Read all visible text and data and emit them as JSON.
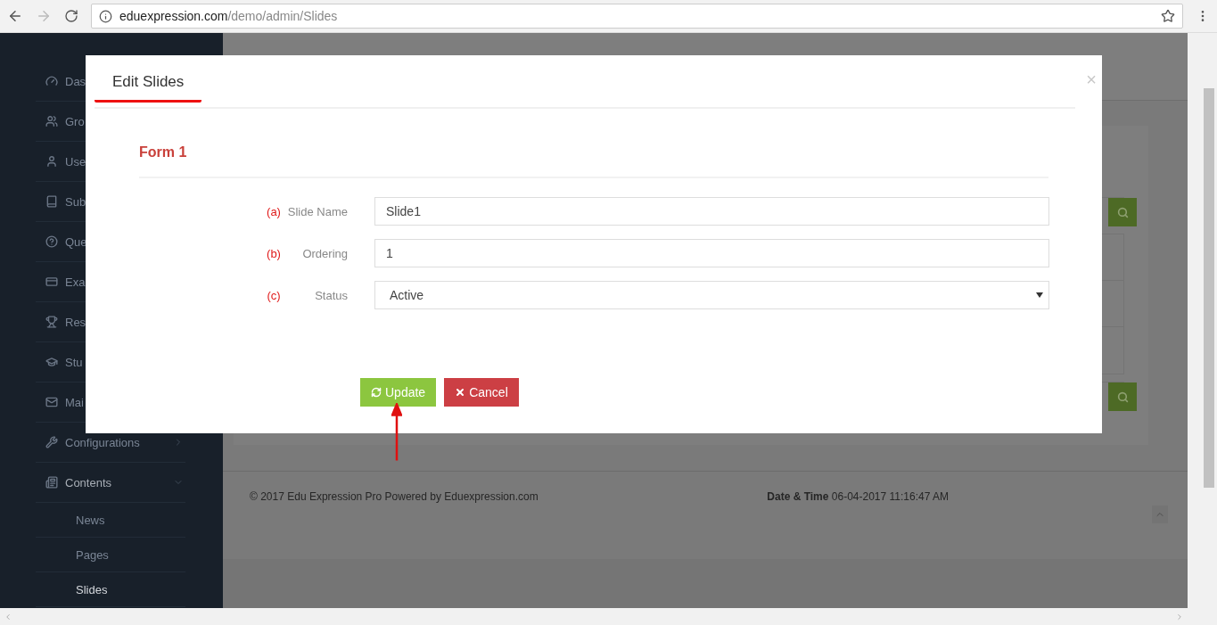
{
  "browser": {
    "url_host": "eduexpression.com",
    "url_path": "/demo/admin/Slides"
  },
  "sidebar": {
    "items": [
      {
        "label": "Das",
        "kind": "link",
        "selected": false
      },
      {
        "label": "Gro",
        "kind": "link",
        "selected": false
      },
      {
        "label": "Use",
        "kind": "link",
        "selected": false
      },
      {
        "label": "Sub",
        "kind": "link",
        "selected": false
      },
      {
        "label": "Que",
        "kind": "link",
        "selected": false
      },
      {
        "label": "Exa",
        "kind": "link",
        "selected": false
      },
      {
        "label": "Res",
        "kind": "link",
        "selected": false
      },
      {
        "label": "Stu",
        "kind": "link",
        "selected": false
      },
      {
        "label": "Mai",
        "kind": "link",
        "selected": false
      },
      {
        "label": "Configurations",
        "kind": "group",
        "selected": false,
        "expanded": false
      },
      {
        "label": "Contents",
        "kind": "group",
        "selected": false,
        "expanded": true,
        "children": [
          {
            "label": "News",
            "selected": false
          },
          {
            "label": "Pages",
            "selected": false
          },
          {
            "label": "Slides",
            "selected": true
          }
        ]
      }
    ]
  },
  "modal": {
    "tab": "Edit Slides",
    "close": "×",
    "section_title": "Form 1",
    "fields": [
      {
        "marker": "(a)",
        "label": "Slide Name",
        "value": "Slide1",
        "kind": "text"
      },
      {
        "marker": "(b)",
        "label": "Ordering",
        "value": "1",
        "kind": "text"
      },
      {
        "marker": "(c)",
        "label": "Status",
        "value": "Active",
        "kind": "select"
      }
    ],
    "buttons": [
      {
        "label": "Update",
        "kind": "primary"
      },
      {
        "label": "Cancel",
        "kind": "danger"
      }
    ]
  },
  "footer": {
    "copyright": "© 2017 Edu Expression Pro Powered by Eduexpression.com",
    "datetime_label": "Date & Time",
    "datetime_value": "06-04-2017 11:16:47 AM"
  }
}
